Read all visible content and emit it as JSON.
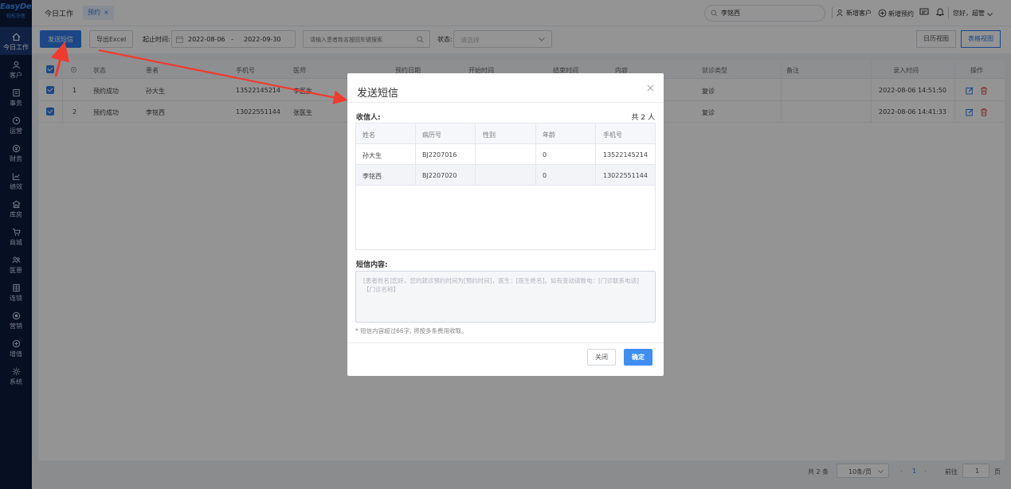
{
  "app": {
    "logo_main": "EasyDent",
    "logo_sub": "轻松牙医"
  },
  "sidebar": {
    "items": [
      {
        "label": "今日工作",
        "icon": "home-icon"
      },
      {
        "label": "客户",
        "icon": "customer-icon"
      },
      {
        "label": "事务",
        "icon": "task-icon"
      },
      {
        "label": "运营",
        "icon": "clock-icon"
      },
      {
        "label": "财务",
        "icon": "finance-icon"
      },
      {
        "label": "绩效",
        "icon": "chart-icon"
      },
      {
        "label": "库房",
        "icon": "warehouse-icon"
      },
      {
        "label": "商城",
        "icon": "cart-icon"
      },
      {
        "label": "医患",
        "icon": "doctor-patient-icon"
      },
      {
        "label": "连锁",
        "icon": "chain-icon"
      },
      {
        "label": "营销",
        "icon": "marketing-icon"
      },
      {
        "label": "增值",
        "icon": "value-added-icon"
      },
      {
        "label": "系统",
        "icon": "settings-icon"
      }
    ]
  },
  "header": {
    "home_tab": "今日工作",
    "active_tab": "预约",
    "active_tab_close": "×",
    "search_value": "李铭西",
    "new_customer": "新增客户",
    "new_appointment": "新增预约",
    "greeting": "您好，超管"
  },
  "toolbar": {
    "send_sms": "发送短信",
    "export_excel": "导出Excel",
    "time_label": "起止时间:",
    "date_start": "2022-08-06",
    "date_sep": "-",
    "date_end": "2022-09-30",
    "patient_search_placeholder": "请输入患者姓名按回车键搜索",
    "status_label": "状态:",
    "status_placeholder": "请选择",
    "calendar_view": "日历视图",
    "table_view": "表格视图"
  },
  "table": {
    "columns": {
      "index": "",
      "status": "状态",
      "patient": "患者",
      "phone": "手机号",
      "doctor": "医师",
      "appt_date": "预约日期",
      "start_time": "开始时间",
      "end_time": "结束时间",
      "content": "内容",
      "visit_type": "就诊类型",
      "remark": "备注",
      "created_at": "录入时间",
      "actions": "操作"
    },
    "rows": [
      {
        "index": "1",
        "status": "预约成功",
        "patient": "孙大生",
        "phone": "13522145214",
        "doctor": "李医生",
        "visit_type": "复诊",
        "created_at": "2022-08-06 14:51:50"
      },
      {
        "index": "2",
        "status": "预约成功",
        "patient": "李铭西",
        "phone": "13022551144",
        "doctor": "张医生",
        "visit_type": "复诊",
        "created_at": "2022-08-06 14:41:33"
      }
    ]
  },
  "pagination": {
    "total": "共 2 条",
    "page_size": "10条/页",
    "current_page": "1",
    "goto_label": "前往",
    "goto_value": "1",
    "page_unit": "页"
  },
  "dialog": {
    "title": "发送短信",
    "close": "×",
    "recipients_label": "收信人:",
    "recipients_count": "共 2 人",
    "columns": {
      "name": "姓名",
      "record_no": "病历号",
      "gender": "性别",
      "age": "年龄",
      "phone": "手机号"
    },
    "rows": [
      {
        "name": "孙大生",
        "record_no": "BJ2207016",
        "gender": "",
        "age": "0",
        "phone": "13522145214"
      },
      {
        "name": "李铭西",
        "record_no": "BJ2207020",
        "gender": "",
        "age": "0",
        "phone": "13022551144"
      }
    ],
    "sms_label": "短信内容:",
    "sms_content": "[患者姓名]您好，您的就诊预约时间为[预约时间]，医生：[医生姓名]。如有变动请致电：[门诊联系电话]【门诊名称】",
    "sms_hint": "* 短信内容超过66字, 将按多条费用收取。",
    "cancel": "关闭",
    "confirm": "确定"
  },
  "colors": {
    "primary": "#2f7be8",
    "sidebar_bg": "#0d1b3d",
    "delete_icon": "#e05050",
    "annotation_arrow": "#f03a2e"
  }
}
